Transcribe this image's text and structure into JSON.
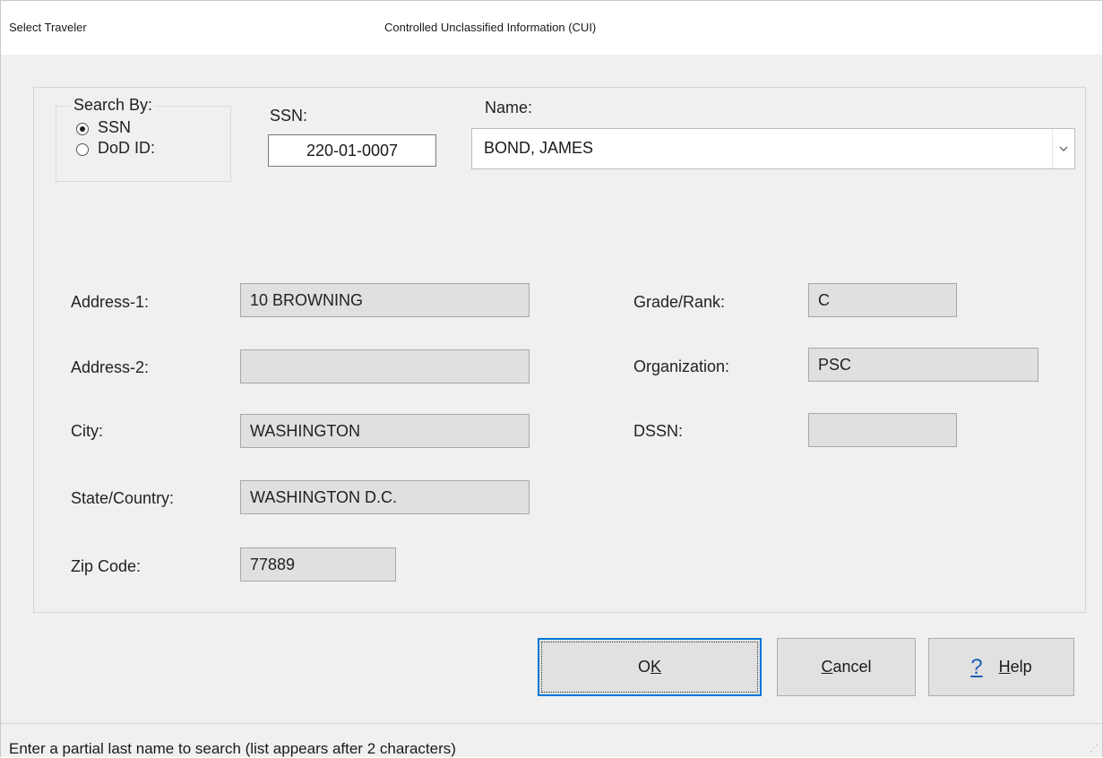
{
  "window": {
    "title": "Select Traveler",
    "classification": "Controlled Unclassified Information (CUI)"
  },
  "search_by": {
    "label": "Search By:",
    "options": [
      {
        "label": "SSN",
        "selected": true
      },
      {
        "label": "DoD ID:",
        "selected": false
      }
    ]
  },
  "ssn": {
    "label": "SSN:",
    "value": "220-01-0007"
  },
  "name": {
    "label": "Name:",
    "value": "BOND, JAMES"
  },
  "fields": {
    "address1": {
      "label": "Address-1:",
      "value": "10 BROWNING"
    },
    "address2": {
      "label": "Address-2:",
      "value": ""
    },
    "city": {
      "label": "City:",
      "value": "WASHINGTON"
    },
    "state_country": {
      "label": "State/Country:",
      "value": "WASHINGTON D.C."
    },
    "zip": {
      "label": "Zip Code:",
      "value": "77889"
    },
    "grade_rank": {
      "label": "Grade/Rank:",
      "value": "C"
    },
    "organization": {
      "label": "Organization:",
      "value": "PSC"
    },
    "dssn": {
      "label": "DSSN:",
      "value": ""
    }
  },
  "buttons": {
    "ok_prefix": "O",
    "ok_u": "K",
    "cancel_u": "C",
    "cancel_rest": "ancel",
    "help_icon": "?",
    "help_u": "H",
    "help_rest": "elp"
  },
  "status": {
    "text": "Enter a partial last name to search (list appears after 2 characters)"
  },
  "icons": {
    "dropdown": "chevron-down-icon",
    "help": "question-mark-icon",
    "resize": "resize-grip-icon"
  },
  "colors": {
    "default_button_border": "#0078d7",
    "help_icon": "#1e5fb4"
  }
}
